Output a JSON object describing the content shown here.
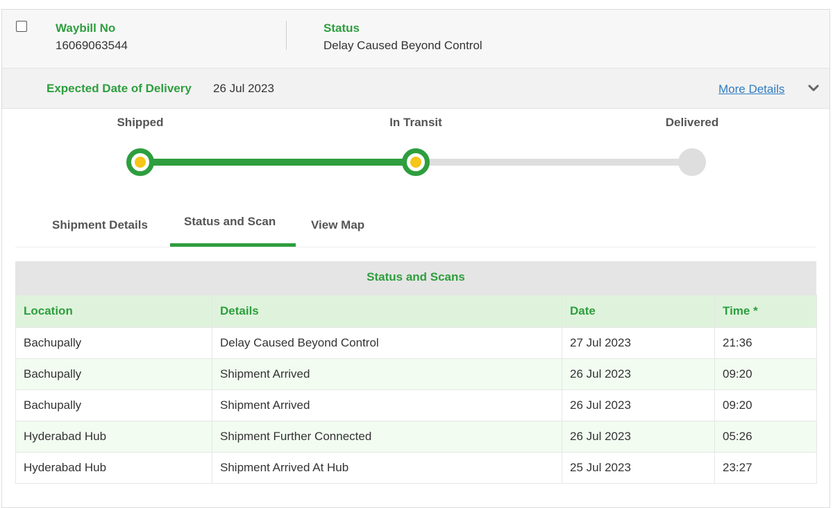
{
  "header": {
    "waybill_label": "Waybill No",
    "waybill_value": "16069063544",
    "status_label": "Status",
    "status_value": "Delay Caused Beyond Control"
  },
  "edd": {
    "label": "Expected Date of Delivery",
    "value": "26 Jul 2023",
    "more_details": "More Details",
    "chevron_icon": "chevron-down-icon"
  },
  "progress": {
    "steps": [
      {
        "label": "Shipped",
        "state": "done"
      },
      {
        "label": "In Transit",
        "state": "done"
      },
      {
        "label": "Delivered",
        "state": "pending"
      }
    ],
    "colors": {
      "done": "#2e9e3e",
      "dot": "#f5c518",
      "pending": "#dedede"
    }
  },
  "tabs": [
    {
      "label": "Shipment Details"
    },
    {
      "label": "Status and Scan",
      "active": true
    },
    {
      "label": "View Map"
    }
  ],
  "scans": {
    "title": "Status and Scans",
    "columns": [
      "Location",
      "Details",
      "Date",
      "Time *"
    ],
    "rows": [
      [
        "Bachupally",
        "Delay Caused Beyond Control",
        "27 Jul 2023",
        "21:36"
      ],
      [
        "Bachupally",
        "Shipment Arrived",
        "26 Jul 2023",
        "09:20"
      ],
      [
        "Bachupally",
        "Shipment Arrived",
        "26 Jul 2023",
        "09:20"
      ],
      [
        "Hyderabad Hub",
        "Shipment Further Connected",
        "26 Jul 2023",
        "05:26"
      ],
      [
        "Hyderabad Hub",
        "Shipment Arrived At Hub",
        "25 Jul 2023",
        "23:27"
      ]
    ]
  },
  "accent_color": "#2e9e3e",
  "link_color": "#2f7cc1"
}
